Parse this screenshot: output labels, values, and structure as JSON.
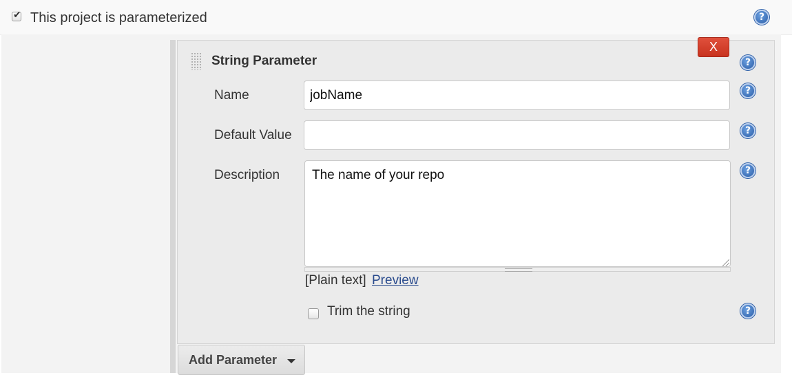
{
  "parameterized": {
    "label": "This project is parameterized",
    "checked": true
  },
  "help_icon": "question-mark-icon",
  "string_parameter": {
    "title": "String Parameter",
    "delete_label": "X",
    "name": {
      "label": "Name",
      "value": "jobName"
    },
    "default_value": {
      "label": "Default Value",
      "value": ""
    },
    "description": {
      "label": "Description",
      "value": "The name of your repo"
    },
    "format": {
      "plain_text": "[Plain text]",
      "preview": "Preview"
    },
    "trim": {
      "label": "Trim the string",
      "checked": false
    }
  },
  "add_parameter": {
    "label": "Add Parameter",
    "icon": "chevron-down-icon"
  },
  "colors": {
    "delete_red": "#d9412c",
    "link_blue": "#2a4b8d",
    "help_blue": "#2d5fa8"
  }
}
